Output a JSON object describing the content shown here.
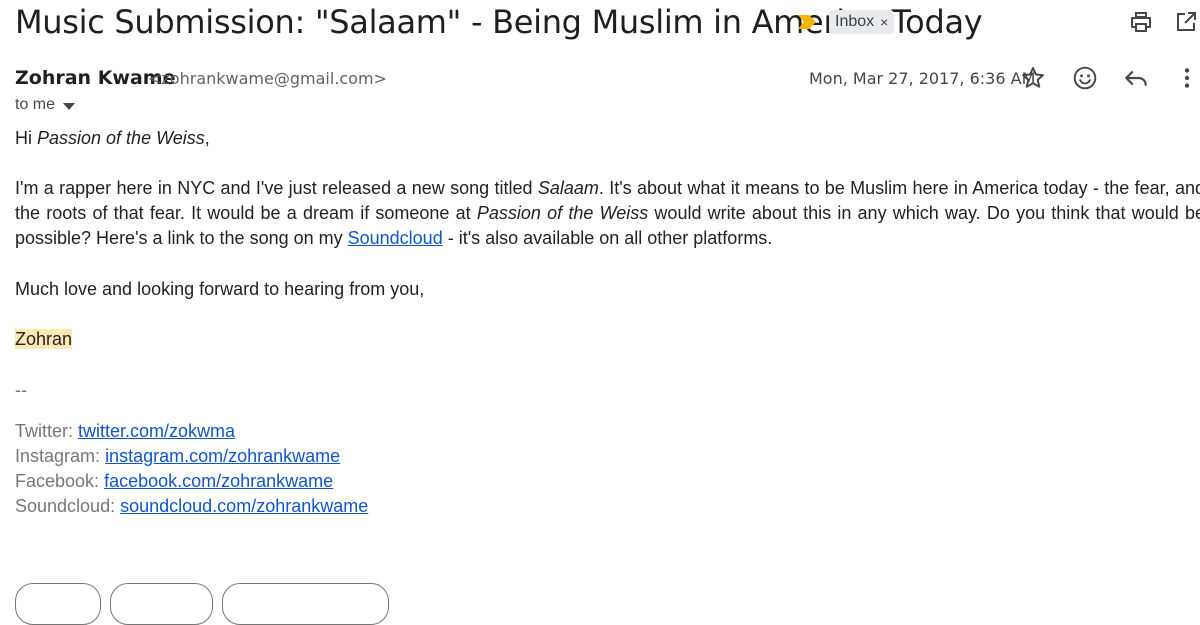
{
  "email": {
    "subject": "Music Submission: \"Salaam\" - Being Muslim in America Today",
    "label_chip": "Inbox",
    "label_chip_close": "×",
    "sender_name": "Zohran Kwame",
    "sender_email": "<zohrankwame@gmail.com>",
    "date": "Mon, Mar 27, 2017, 6:36 AM",
    "recipient": "to me"
  },
  "body": {
    "greeting_prefix": "Hi ",
    "greeting_name": "Passion of the Weiss",
    "greeting_suffix": ",",
    "p1_a": "I'm a rapper here in NYC and I've just released a new song titled ",
    "p1_song": "Salaam",
    "p1_b": ". It's about what it means to be Muslim here in America today - the fear, and the roots of that fear. It would be a dream if someone at ",
    "p1_blog": "Passion of the Weiss",
    "p1_c": " would write about this in any which way. Do you think that would be possible? Here's a link to the song on my ",
    "p1_link": "Soundcloud",
    "p1_d": " - it's also available on all other platforms.",
    "closing": "Much love and looking forward to hearing from you,",
    "signoff": "Zohran",
    "separator": "--"
  },
  "signature": {
    "twitter_label": "Twitter:",
    "twitter_link": "twitter.com/zokwma",
    "instagram_label": "Instagram:",
    "instagram_link": "instagram.com/zohrankwame",
    "facebook_label": "Facebook:",
    "facebook_link": "facebook.com/zohrankwame",
    "soundcloud_label": "Soundcloud:",
    "soundcloud_link": "soundcloud.com/zohrankwame"
  },
  "icons": {
    "importance": "importance-marker-icon",
    "print": "print-icon",
    "popout": "open-in-new-window-icon",
    "star": "star-icon",
    "emoji": "emoji-reaction-icon",
    "reply": "reply-icon",
    "more": "more-vert-icon"
  },
  "colors": {
    "importance": "#f4b400",
    "link": "#1155cc",
    "highlight": "#fce8b2",
    "chip_bg": "#e8eaed"
  }
}
